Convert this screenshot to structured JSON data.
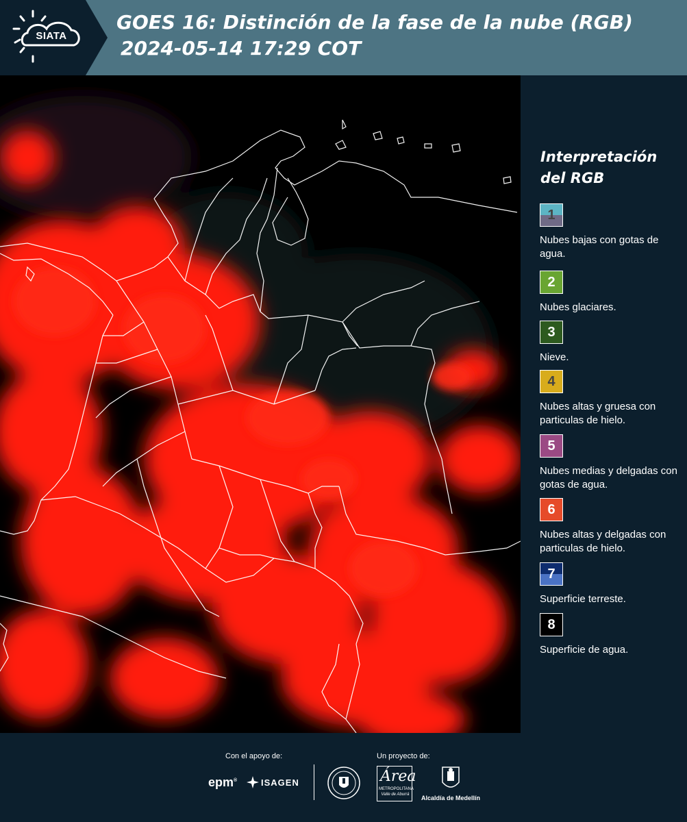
{
  "header": {
    "logo_text": "SIATA",
    "title_line1": "GOES 16: Distinción de la fase de la nube (RGB)",
    "title_line2": "2024-05-14 17:29 COT"
  },
  "legend": {
    "title_line1": "Interpretación",
    "title_line2": "del RGB",
    "items": [
      {
        "number": "1",
        "label": "Nubes bajas con gotas de agua.",
        "color_top": "#5cb4c4",
        "color_bottom": "#6f6a86",
        "text_color": "#444444"
      },
      {
        "number": "2",
        "label": "Nubes glaciares.",
        "color_top": "#69a532",
        "color_bottom": "#69a532",
        "text_color": "#ffffff"
      },
      {
        "number": "3",
        "label": "Nieve.",
        "color_top": "#2d5a1f",
        "color_bottom": "#2d5a1f",
        "text_color": "#ffffff"
      },
      {
        "number": "4",
        "label": "Nubes altas y gruesa con particulas de hielo.",
        "color_top": "#d8ac1c",
        "color_bottom": "#d8ac1c",
        "text_color": "#444444"
      },
      {
        "number": "5",
        "label": "Nubes medias y delgadas con gotas de agua.",
        "color_top": "#9b4a84",
        "color_bottom": "#9b4a84",
        "text_color": "#ffffff"
      },
      {
        "number": "6",
        "label": "Nubes altas y delgadas con particulas de hielo.",
        "color_top": "#e64b2a",
        "color_bottom": "#e64b2a",
        "text_color": "#ffffff"
      },
      {
        "number": "7",
        "label": "Superficie terreste.",
        "color_top": "#0d2c6e",
        "color_bottom": "#4a72c4",
        "text_color": "#ffffff"
      },
      {
        "number": "8",
        "label": "Superficie de agua.",
        "color_top": "#000000",
        "color_bottom": "#000000",
        "text_color": "#ffffff"
      }
    ]
  },
  "footer": {
    "support_label": "Con el apoyo de:",
    "project_label": "Un proyecto de:",
    "epm": "epm",
    "epm_mark": "®",
    "isagen": "ISAGEN",
    "amva_mark": "Área",
    "amva_line1": "METROPOLITANA",
    "amva_line2": "Valle de Aburrá",
    "medellin": "Alcaldía de Medellín"
  },
  "colors": {
    "header_bg": "#4d7483",
    "panel_bg": "#0c1f2d",
    "cloud_red": "#ff1a10",
    "border_white": "#ffffff"
  }
}
